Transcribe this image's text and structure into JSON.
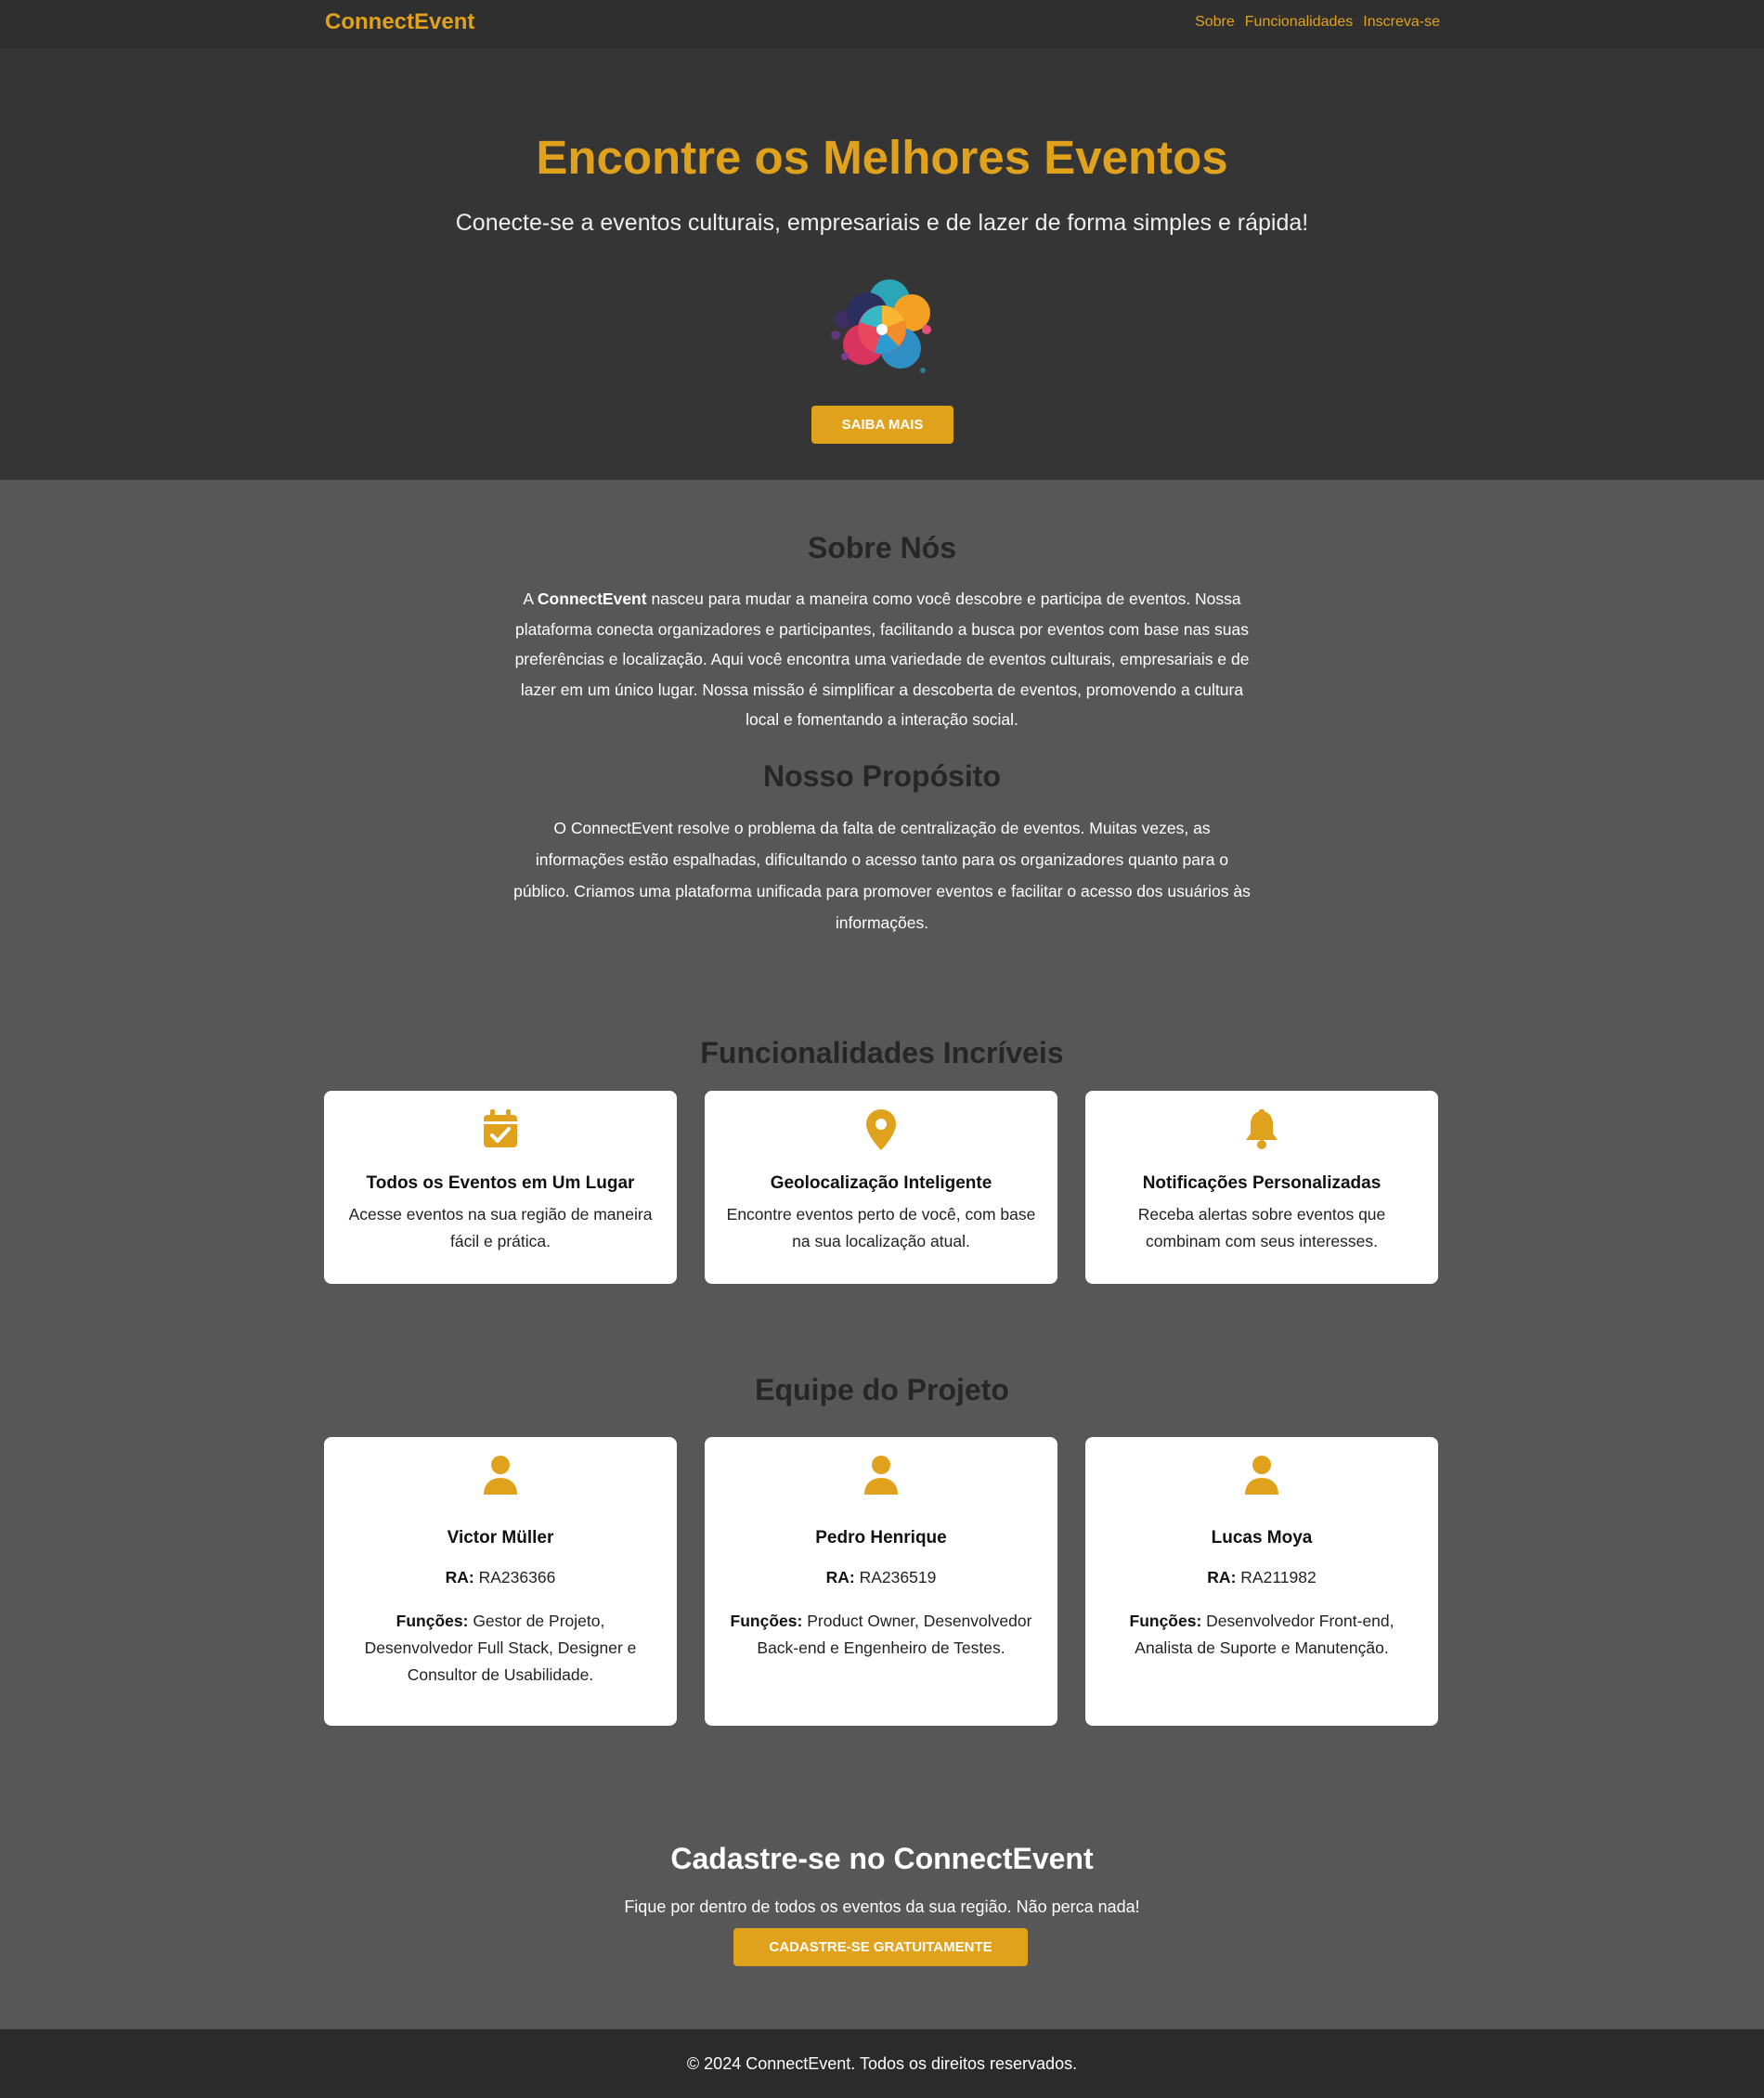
{
  "navbar": {
    "brand": "ConnectEvent",
    "links": [
      "Sobre",
      "Funcionalidades",
      "Inscreva-se"
    ]
  },
  "hero": {
    "title": "Encontre os Melhores Eventos",
    "subtitle": "Conecte-se a eventos culturais, empresariais e de lazer de forma simples e rápida!",
    "button": "Saiba Mais"
  },
  "about": {
    "title": "Sobre Nós",
    "text_prefix": "A ",
    "brand": "ConnectEvent",
    "text_rest": " nasceu para mudar a maneira como você descobre e participa de eventos. Nossa plataforma conecta organizadores e participantes, facilitando a busca por eventos com base nas suas preferências e localização. Aqui você encontra uma variedade de eventos culturais, empresariais e de lazer em um único lugar. Nossa missão é simplificar a descoberta de eventos, promovendo a cultura local e fomentando a interação social."
  },
  "purpose": {
    "title": "Nosso Propósito",
    "text": "O ConnectEvent resolve o problema da falta de centralização de eventos. Muitas vezes, as informações estão espalhadas, dificultando o acesso tanto para os organizadores quanto para o público. Criamos uma plataforma unificada para promover eventos e facilitar o acesso dos usuários às informações."
  },
  "features": {
    "title": "Funcionalidades Incríveis",
    "items": [
      {
        "icon": "calendar-check-icon",
        "title": "Todos os Eventos em Um Lugar",
        "desc": "Acesse eventos na sua região de maneira fácil e prática."
      },
      {
        "icon": "map-pin-icon",
        "title": "Geolocalização Inteligente",
        "desc": "Encontre eventos perto de você, com base na sua localização atual."
      },
      {
        "icon": "bell-icon",
        "title": "Notificações Personalizadas",
        "desc": "Receba alertas sobre eventos que combinam com seus interesses."
      }
    ]
  },
  "team": {
    "title": "Equipe do Projeto",
    "ra_label": "RA:",
    "roles_label": "Funções:",
    "members": [
      {
        "icon": "user-icon",
        "name": "Victor Müller",
        "ra": "RA236366",
        "roles": "Gestor de Projeto, Desenvolvedor Full Stack, Designer e Consultor de Usabilidade."
      },
      {
        "icon": "user-icon",
        "name": "Pedro Henrique",
        "ra": "RA236519",
        "roles": "Product Owner, Desenvolvedor Back-end e Engenheiro de Testes."
      },
      {
        "icon": "user-icon",
        "name": "Lucas Moya",
        "ra": "RA211982",
        "roles": "Desenvolvedor Front-end, Analista de Suporte e Manutenção."
      }
    ]
  },
  "cta": {
    "title": "Cadastre-se no ConnectEvent",
    "subtitle": "Fique por dentro de todos os eventos da sua região. Não perca nada!",
    "button": "Cadastre-se Gratuitamente"
  },
  "footer": {
    "text": "© 2024 ConnectEvent. Todos os direitos reservados."
  },
  "colors": {
    "accent": "#e0a21c",
    "navbar_bg": "#2f2f2f",
    "hero_bg": "#353535",
    "page_bg": "#575757",
    "footer_bg": "#2b2b2b"
  }
}
